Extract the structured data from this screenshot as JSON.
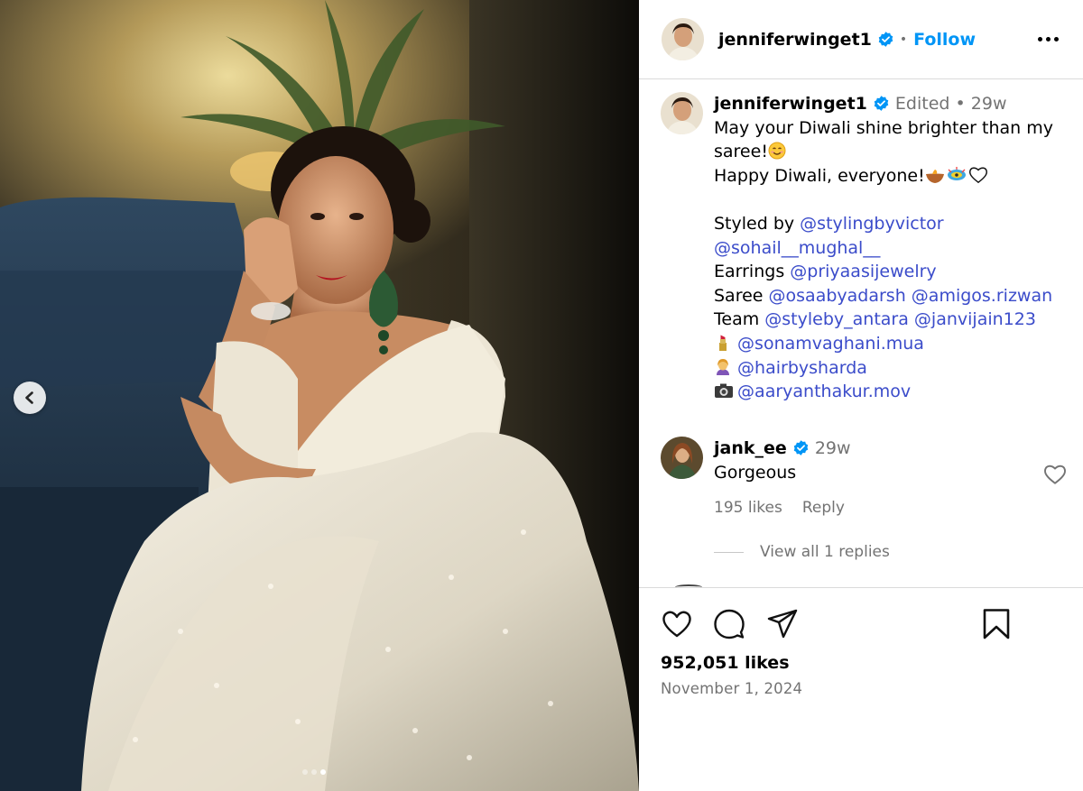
{
  "post": {
    "image_count": 3,
    "active_image_index": 3
  },
  "header": {
    "username": "jenniferwinget1",
    "separator": "•",
    "follow_label": "Follow",
    "more_icon": "more-horizontal-icon"
  },
  "caption": {
    "username": "jenniferwinget1",
    "edited": "Edited",
    "separator": "•",
    "time": "29w",
    "line1": "May your Diwali shine brighter than my",
    "line2": "saree!",
    "line3": "Happy Diwali, everyone!",
    "styled_by": "Styled by ",
    "mention_styling": "@stylingbyvictor",
    "mention_sohail": "@sohail__mughal__",
    "earrings": "Earrings ",
    "mention_earrings": "@priyaasijewelry",
    "saree": "Saree ",
    "mention_saree1": "@osaabyadarsh",
    "mention_saree2": "@amigos.rizwan",
    "team": "Team ",
    "mention_team1": "@styleby_antara",
    "mention_team2": "@janvijain123",
    "mention_makeup": "@sonamvaghani.mua",
    "mention_hair": "@hairbysharda",
    "mention_photo": "@aaryanthakur.mov",
    "emoji_icons": [
      "smiling-face-icon",
      "diya-lamp-icon",
      "firecracker-icon",
      "white-heart-icon",
      "lipstick-icon",
      "hairdresser-icon",
      "camera-icon"
    ]
  },
  "comment": {
    "username": "jank_ee",
    "time": "29w",
    "text": "Gorgeous",
    "likes": "195 likes",
    "reply_label": "Reply",
    "view_replies": "View all 1 replies"
  },
  "actions": {
    "likes": "952,051 likes",
    "date": "November 1, 2024"
  },
  "colors": {
    "link": "#3b4cca",
    "follow": "#0095f6",
    "verified": "#0095f6",
    "muted": "#737373",
    "border": "#dbdbdb"
  }
}
